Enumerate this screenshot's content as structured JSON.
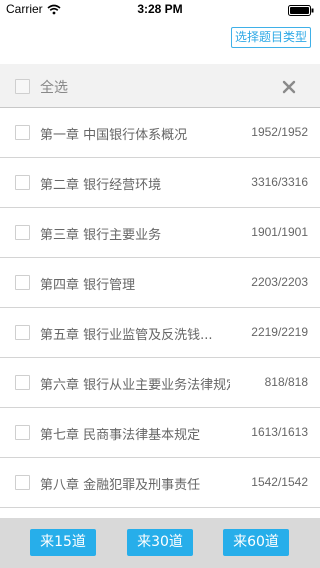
{
  "status_bar": {
    "carrier": "Carrier",
    "time": "3:28 PM"
  },
  "header": {
    "type_button_label": "选择题目类型",
    "accent_color": "#2ea9e6"
  },
  "select_all": {
    "label": "全选"
  },
  "chapters": [
    {
      "title": "第一章  中国银行体系概况",
      "count": "1952/1952"
    },
    {
      "title": "第二章  银行经营环境",
      "count": "3316/3316"
    },
    {
      "title": "第三章  银行主要业务",
      "count": "1901/1901"
    },
    {
      "title": "第四章  银行管理",
      "count": "2203/2203"
    },
    {
      "title": "第五章  银行业监管及反洗钱...",
      "count": "2219/2219"
    },
    {
      "title": "第六章  银行从业主要业务法律规定",
      "count": "818/818"
    },
    {
      "title": "第七章  民商事法律基本规定",
      "count": "1613/1613"
    },
    {
      "title": "第八章  金融犯罪及刑事责任",
      "count": "1542/1542"
    }
  ],
  "bottom_bar": {
    "buttons": [
      "来15道",
      "来30道",
      "来60道"
    ],
    "button_color": "#27aeea"
  }
}
